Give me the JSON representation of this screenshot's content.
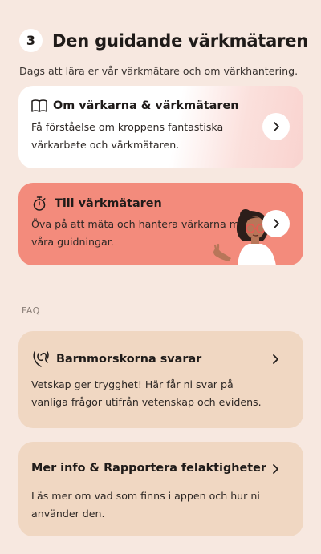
{
  "header": {
    "step_number": "3",
    "title": "Den guidande värkmätaren",
    "description": "Dags att lära er vår värkmätare och om värkhantering."
  },
  "cards": [
    {
      "title": "Om värkarna & värkmätaren",
      "text_line1": "Få förståelse om kroppens fantastiska",
      "text_line2": "värkarbete och värkmätaren.",
      "icon": "open-book-icon"
    },
    {
      "title": "Till värkmätaren",
      "text_line1": "Öva på att mäta och hantera värkarna med hjälp",
      "text_line2": "våra guidningar.",
      "icon": "stopwatch-icon"
    }
  ],
  "faq": {
    "label": "FAQ",
    "items": [
      {
        "title": "Barnmorskorna svarar",
        "text_line1": "Vetskap ger trygghet! Här får ni svar på",
        "text_line2": "vanliga frågor utifrån vetenskap och evidens.",
        "icon": "midwife-hands-icon"
      },
      {
        "title": "Mer info & Rapportera felaktigheter",
        "text_line1": "Läs mer om vad som finns i appen och hur ni",
        "text_line2": "använder den."
      }
    ]
  },
  "colors": {
    "background": "#f7e8e0",
    "coral_card": "#f38b7c",
    "beige_card": "#f0d7c2"
  }
}
